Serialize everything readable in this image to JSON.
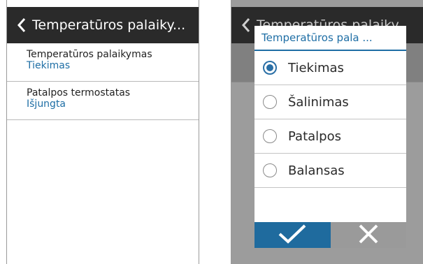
{
  "left_screen": {
    "header": {
      "title": "Temperatūros palaiky..."
    },
    "items": [
      {
        "label": "Temperatūros palaikymas",
        "value": "Tiekimas"
      },
      {
        "label": "Patalpos termostatas",
        "value": "Išjungta"
      }
    ]
  },
  "right_screen": {
    "header": {
      "title": "Temperatūros palaiky"
    },
    "dialog": {
      "title": "Temperatūros pala ...",
      "options": [
        {
          "label": "Tiekimas",
          "selected": true
        },
        {
          "label": "Šalinimas",
          "selected": false
        },
        {
          "label": "Patalpos",
          "selected": false
        },
        {
          "label": "Balansas",
          "selected": false
        }
      ]
    }
  },
  "colors": {
    "header_bg": "#2a2a2a",
    "accent": "#1f6b9e",
    "value_text": "#1e6ea5",
    "cancel_bg": "#9a9a9a"
  },
  "icons": {
    "back": "chevron-left-icon",
    "confirm": "check-icon",
    "cancel": "close-icon"
  }
}
